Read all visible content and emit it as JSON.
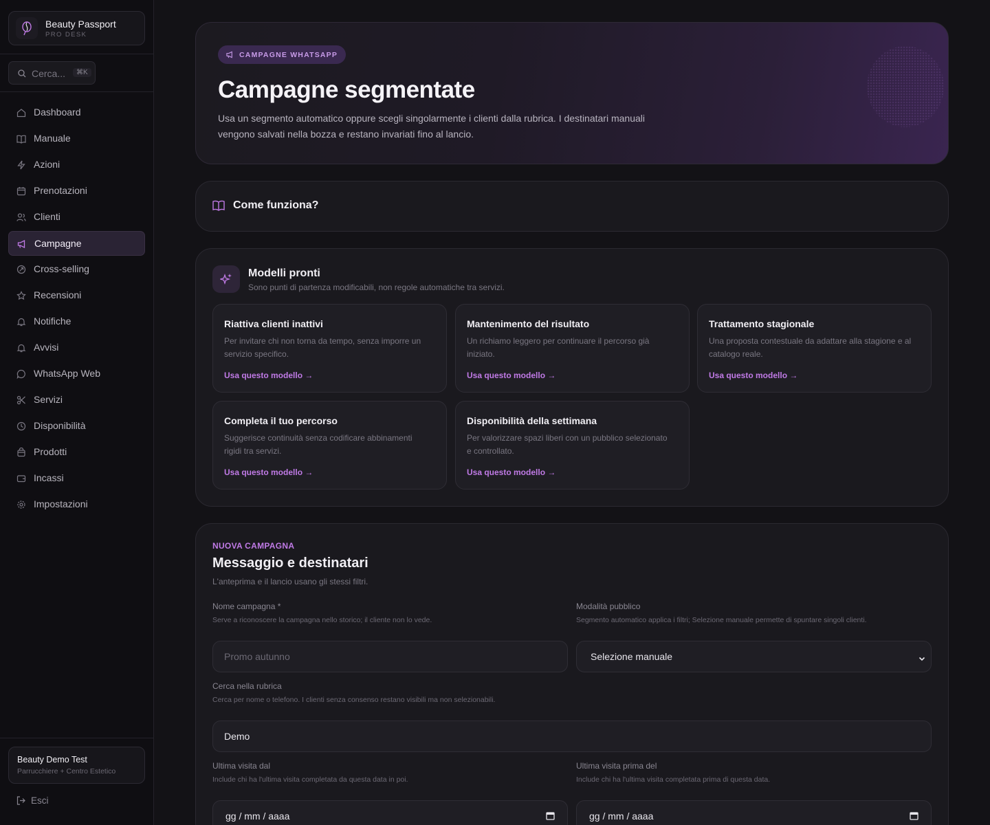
{
  "brand": {
    "title": "Beauty Passport",
    "subtitle": "PRO DESK"
  },
  "search": {
    "placeholder": "Cerca...",
    "shortcut": "⌘K"
  },
  "nav": [
    {
      "label": "Dashboard",
      "icon": "home-icon"
    },
    {
      "label": "Manuale",
      "icon": "book-icon"
    },
    {
      "label": "Azioni",
      "icon": "bolt-icon"
    },
    {
      "label": "Prenotazioni",
      "icon": "calendar-icon"
    },
    {
      "label": "Clienti",
      "icon": "users-icon"
    },
    {
      "label": "Campagne",
      "icon": "megaphone-icon",
      "active": true
    },
    {
      "label": "Cross-selling",
      "icon": "crosssell-icon"
    },
    {
      "label": "Recensioni",
      "icon": "star-icon"
    },
    {
      "label": "Notifiche",
      "icon": "bell-icon"
    },
    {
      "label": "Avvisi",
      "icon": "bell-icon"
    },
    {
      "label": "WhatsApp Web",
      "icon": "chat-icon"
    },
    {
      "label": "Servizi",
      "icon": "scissors-icon"
    },
    {
      "label": "Disponibilità",
      "icon": "clock-icon"
    },
    {
      "label": "Prodotti",
      "icon": "bag-icon"
    },
    {
      "label": "Incassi",
      "icon": "wallet-icon"
    },
    {
      "label": "Impostazioni",
      "icon": "gear-icon"
    }
  ],
  "user": {
    "name": "Beauty Demo Test",
    "role": "Parrucchiere + Centro Estetico"
  },
  "logout": "Esci",
  "hero": {
    "pill": "CAMPAGNE WHATSAPP",
    "title": "Campagne segmentate",
    "description": "Usa un segmento automatico oppure scegli singolarmente i clienti dalla rubrica. I destinatari manuali vengono salvati nella bozza e restano invariati fino al lancio."
  },
  "how": {
    "title": "Come funziona?"
  },
  "models": {
    "title": "Modelli pronti",
    "subtitle": "Sono punti di partenza modificabili, non regole automatiche tra servizi.",
    "link": "Usa questo modello →",
    "items": [
      {
        "title": "Riattiva clienti inattivi",
        "desc": "Per invitare chi non torna da tempo, senza imporre un servizio specifico."
      },
      {
        "title": "Mantenimento del risultato",
        "desc": "Un richiamo leggero per continuare il percorso già iniziato."
      },
      {
        "title": "Trattamento stagionale",
        "desc": "Una proposta contestuale da adattare alla stagione e al catalogo reale."
      },
      {
        "title": "Completa il tuo percorso",
        "desc": "Suggerisce continuità senza codificare abbinamenti rigidi tra servizi."
      },
      {
        "title": "Disponibilità della settimana",
        "desc": "Per valorizzare spazi liberi con un pubblico selezionato e controllato."
      }
    ]
  },
  "form": {
    "eyebrow": "NUOVA CAMPAGNA",
    "title": "Messaggio e destinatari",
    "subtitle": "L'anteprima e il lancio usano gli stessi filtri.",
    "name_label": "Nome campagna *",
    "name_help": "Serve a riconoscere la campagna nello storico; il cliente non lo vede.",
    "name_placeholder": "Promo autunno",
    "mode_label": "Modalità pubblico",
    "mode_help": "Segmento automatico applica i filtri; Selezione manuale permette di spuntare singoli clienti.",
    "mode_value": "Selezione manuale",
    "search_label": "Cerca nella rubrica",
    "search_help": "Cerca per nome o telefono. I clienti senza consenso restano visibili ma non selezionabili.",
    "search_value": "Demo",
    "from_label": "Ultima visita dal",
    "from_help": "Include chi ha l'ultima visita completata da questa data in poi.",
    "from_placeholder": "gg / mm / aaaa",
    "before_label": "Ultima visita prima del",
    "before_help": "Include chi ha l'ultima visita completata prima di questa data.",
    "before_placeholder": "gg / mm / aaaa"
  }
}
